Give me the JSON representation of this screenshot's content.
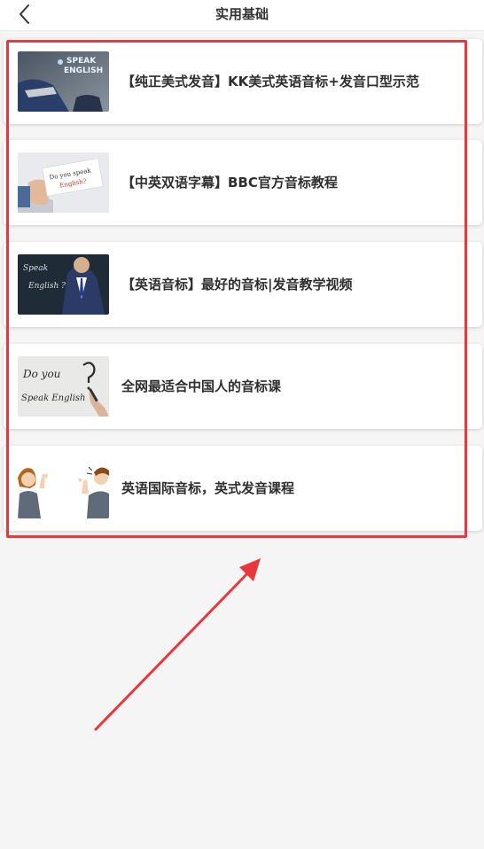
{
  "header": {
    "title": "实用基础"
  },
  "courses": [
    {
      "title": "【纯正美式发音】KK美式英语音标+发音口型示范",
      "thumb_icon": "speak-english-businessman-thumbnail"
    },
    {
      "title": "【中英双语字幕】BBC官方音标教程",
      "thumb_icon": "do-you-speak-english-card-thumbnail"
    },
    {
      "title": "【英语音标】最好的音标|发音教学视频",
      "thumb_icon": "speak-english-chalkboard-thumbnail"
    },
    {
      "title": "全网最适合中国人的音标课",
      "thumb_icon": "do-you-speak-english-whiteboard-thumbnail"
    },
    {
      "title": "英语国际音标，英式发音课程",
      "thumb_icon": "cartoon-people-thumbnail"
    }
  ],
  "thumb_text": {
    "t1_line1": "SPEAK",
    "t1_line2": "ENGLISH",
    "t2_line1": "Do you speak",
    "t2_line2": "English?",
    "t3_line1": "Speak",
    "t3_line2": "English ?",
    "t4_line1": "Do you",
    "t4_line2": "Speak English"
  },
  "annotation": {
    "highlight_color": "#e8383d"
  }
}
